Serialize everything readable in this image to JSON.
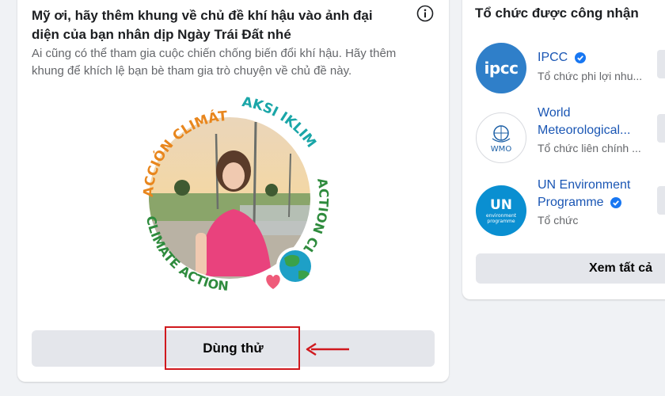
{
  "frame_card": {
    "title": "Mỹ ơi, hãy thêm khung về chủ đề khí hậu vào ảnh đại diện của bạn nhân dịp Ngày Trái Đất nhé",
    "subtitle": "Ai cũng có thể tham gia cuộc chiến chống biến đổi khí hậu. Hãy thêm khung để khích lệ bạn bè tham gia trò chuyện về chủ đề này.",
    "info_icon": "info-icon",
    "frame_texts": {
      "accion": "ACCIÓN CLIMÁTICA",
      "aksi": "AKSI IKLIM",
      "action_climat": "ACTION CLIMAT",
      "climate_action": "CLIMATE ACTION"
    },
    "try_button_label": "Dùng thử",
    "colors": {
      "orange": "#e8861d",
      "teal": "#1aa6a8",
      "green": "#2e8b3d",
      "highlight": "#d0191e"
    }
  },
  "orgs_card": {
    "title": "Tổ chức được công nhận",
    "orgs": [
      {
        "name": "IPCC",
        "verified": true,
        "subtitle": "Tổ chức phi lợi nhu...",
        "logo_text": "ipcc"
      },
      {
        "name": "World Meteorological...",
        "verified": false,
        "subtitle": "Tổ chức liên chính ...",
        "logo_text": "WMO"
      },
      {
        "name_line1": "UN Environment",
        "name_line2": "Programme",
        "verified": true,
        "subtitle": "Tổ chức",
        "logo_text": "UN",
        "logo_sub": "environment programme"
      }
    ],
    "see_all_label": "Xem tất cả"
  }
}
